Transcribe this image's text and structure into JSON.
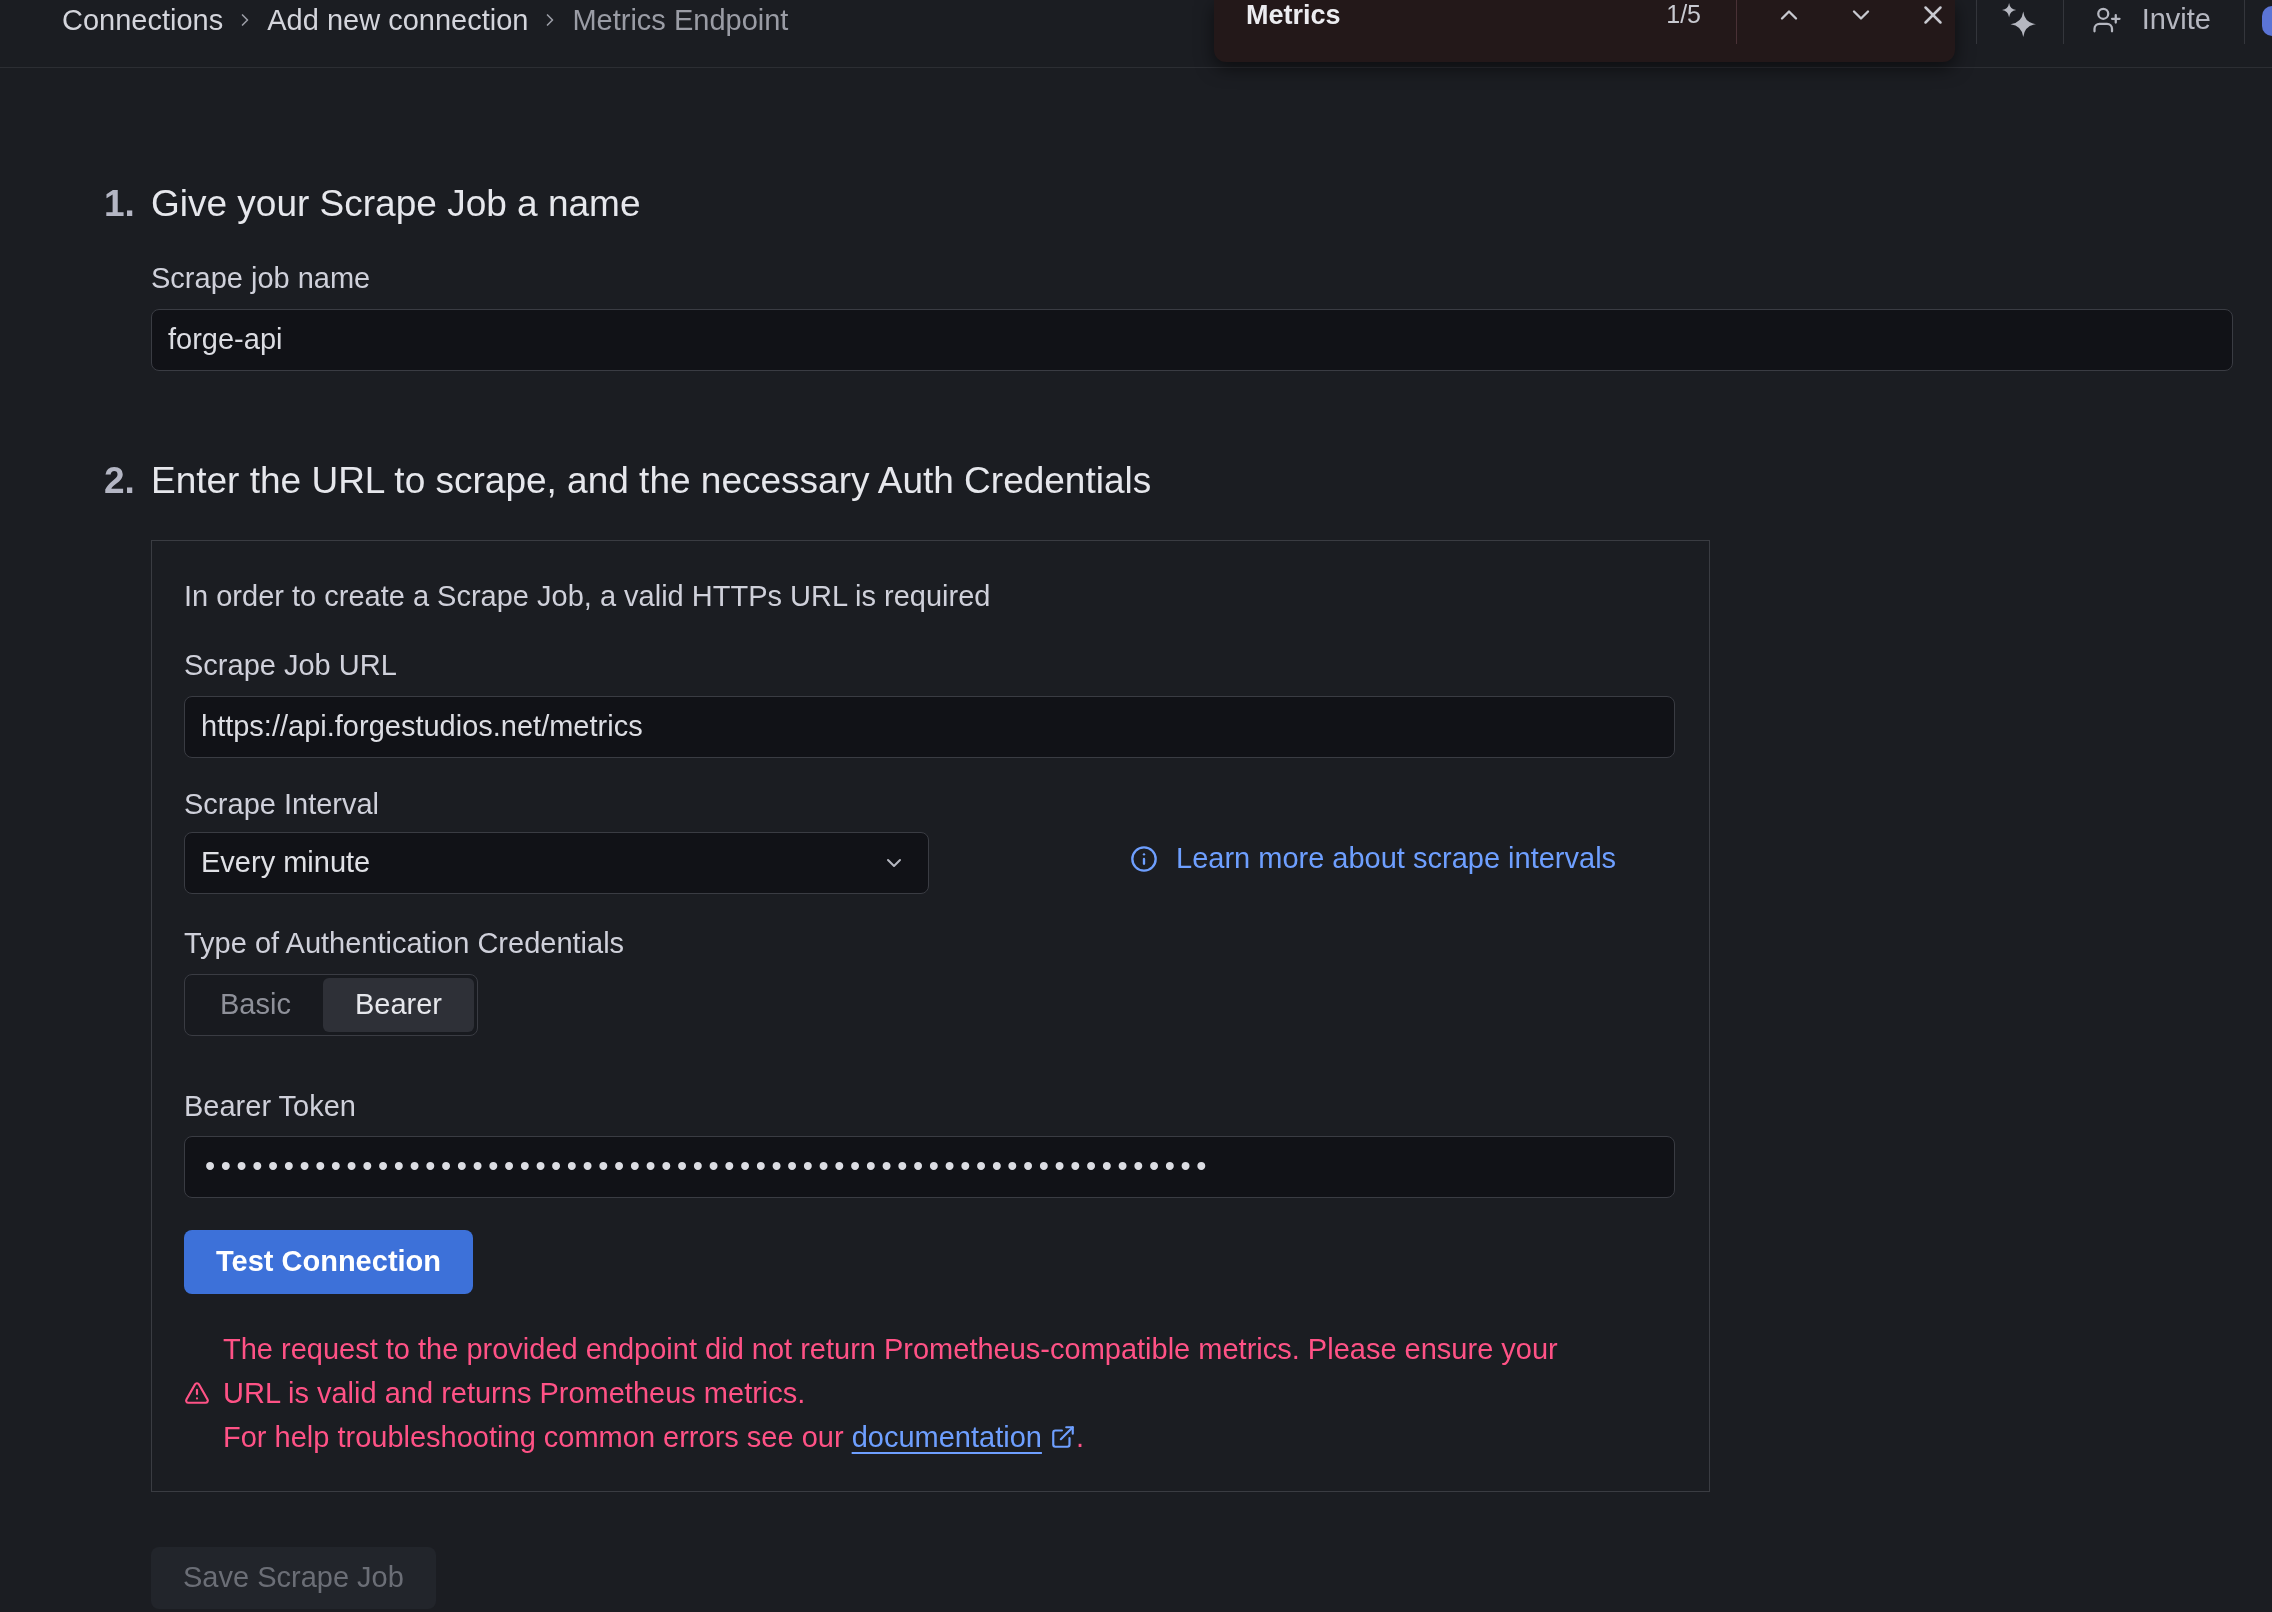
{
  "top_bar": {
    "breadcrumbs": [
      {
        "label": "Connections",
        "current": false
      },
      {
        "label": "Add new connection",
        "current": false
      },
      {
        "label": "Metrics Endpoint",
        "current": true
      }
    ],
    "find_bar": {
      "query": "Metrics",
      "match_count": "1/5"
    },
    "invite_button": {
      "label": "Invite"
    }
  },
  "step_1": {
    "number": "1.",
    "title": "Give your Scrape Job a name",
    "name_field": {
      "label": "Scrape job name",
      "value": "forge-api"
    }
  },
  "step_2": {
    "number": "2.",
    "title": "Enter the URL to scrape, and the necessary Auth Credentials",
    "intro": "In order to create a Scrape Job, a valid HTTPs URL is required",
    "url_field": {
      "label": "Scrape Job URL",
      "value": "https://api.forgestudios.net/metrics"
    },
    "interval": {
      "label": "Scrape Interval",
      "value": "Every minute",
      "help_link": "Learn more about scrape intervals"
    },
    "auth_type": {
      "label": "Type of Authentication Credentials",
      "options": [
        {
          "label": "Basic",
          "selected": false
        },
        {
          "label": "Bearer",
          "selected": true
        }
      ]
    },
    "token_field": {
      "label": "Bearer Token",
      "value": "••••••••••••••••••••••••••••••••••••••••••••••••••••••••••••••••"
    },
    "test_button": {
      "label": "Test Connection"
    },
    "error": {
      "message": "The request to the provided endpoint did not return Prometheus-compatible metrics. Please ensure your URL is valid and returns Prometheus metrics.",
      "help_text": "For help troubleshooting common errors see our",
      "link": "documentation",
      "trailing_text": "."
    }
  },
  "save_button": {
    "label": "Save Scrape Job",
    "disabled": true
  }
}
